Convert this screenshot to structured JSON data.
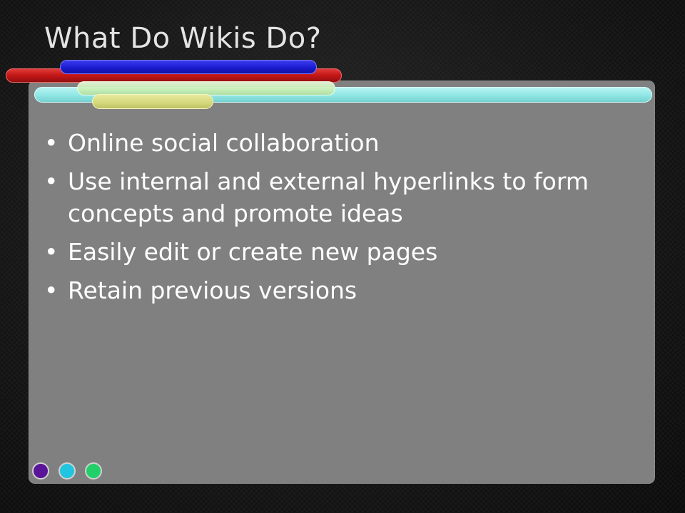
{
  "slide": {
    "title": "What Do Wikis Do?",
    "bullet_glyph": "•",
    "bullets": [
      "Online social collaboration",
      "Use internal and external hyperlinks to form concepts and promote ideas",
      "Easily edit or create new pages",
      "Retain previous versions"
    ]
  },
  "theme": {
    "background": "#111111",
    "panel": "#808080",
    "title_color": "#e4e4e4",
    "text_color": "#ffffff",
    "bar_colors": [
      "#c21616",
      "#1c1cd0",
      "#8fe6e4",
      "#c8efb4",
      "#d4d77a"
    ],
    "dot_colors": [
      "#5a1499",
      "#22c5e0",
      "#22d06a"
    ]
  }
}
